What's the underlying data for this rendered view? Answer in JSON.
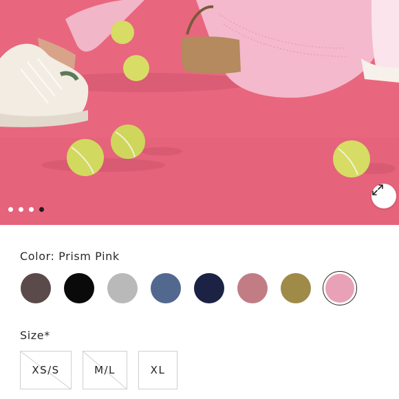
{
  "gallery": {
    "image_alt": "Model sitting on pink court with tennis balls",
    "slide_count": 4,
    "active_slide": 4,
    "expand_icon": "expand-icon"
  },
  "color": {
    "label": "Color: Prism Pink",
    "swatches": [
      {
        "name": "dark-brown",
        "hex": "#5a4a49",
        "selected": false
      },
      {
        "name": "black",
        "hex": "#0a0a0a",
        "selected": false
      },
      {
        "name": "heather-grey",
        "hex": "#b9b9b9",
        "selected": false
      },
      {
        "name": "slate-blue",
        "hex": "#53688f",
        "selected": false
      },
      {
        "name": "navy",
        "hex": "#1c2244",
        "selected": false
      },
      {
        "name": "dusty-rose",
        "hex": "#c27d84",
        "selected": false
      },
      {
        "name": "olive",
        "hex": "#a08a48",
        "selected": false
      },
      {
        "name": "prism-pink",
        "hex": "#e9a1b7",
        "selected": true
      }
    ]
  },
  "size": {
    "label": "Size*",
    "options": [
      {
        "label": "XS/S",
        "available": false
      },
      {
        "label": "M/L",
        "available": false
      },
      {
        "label": "XL",
        "available": true
      }
    ]
  }
}
